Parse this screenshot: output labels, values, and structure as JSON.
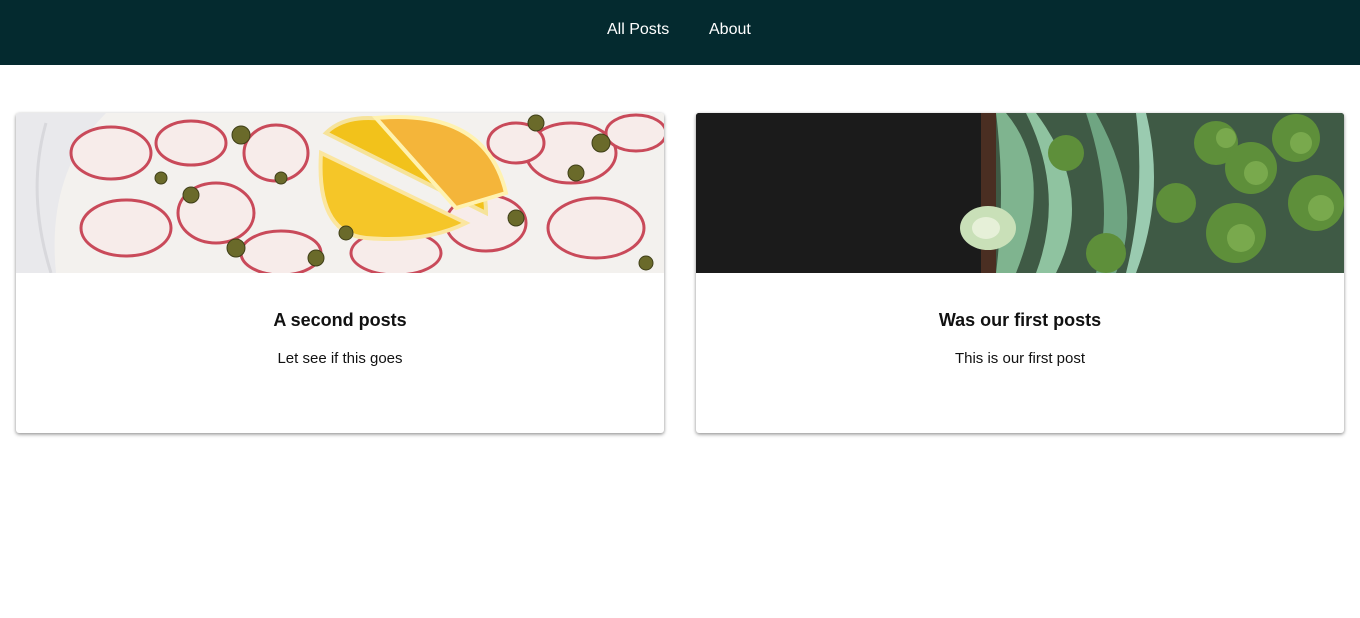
{
  "nav": {
    "items": [
      {
        "label": "All Posts"
      },
      {
        "label": "About"
      }
    ],
    "background": "#042a2f"
  },
  "posts": [
    {
      "title": "A second posts",
      "excerpt": "Let see if this goes",
      "image": "octopus-carpaccio-photo"
    },
    {
      "title": "Was our first posts",
      "excerpt": "This is our first post",
      "image": "broccoli-rabe-photo"
    }
  ]
}
